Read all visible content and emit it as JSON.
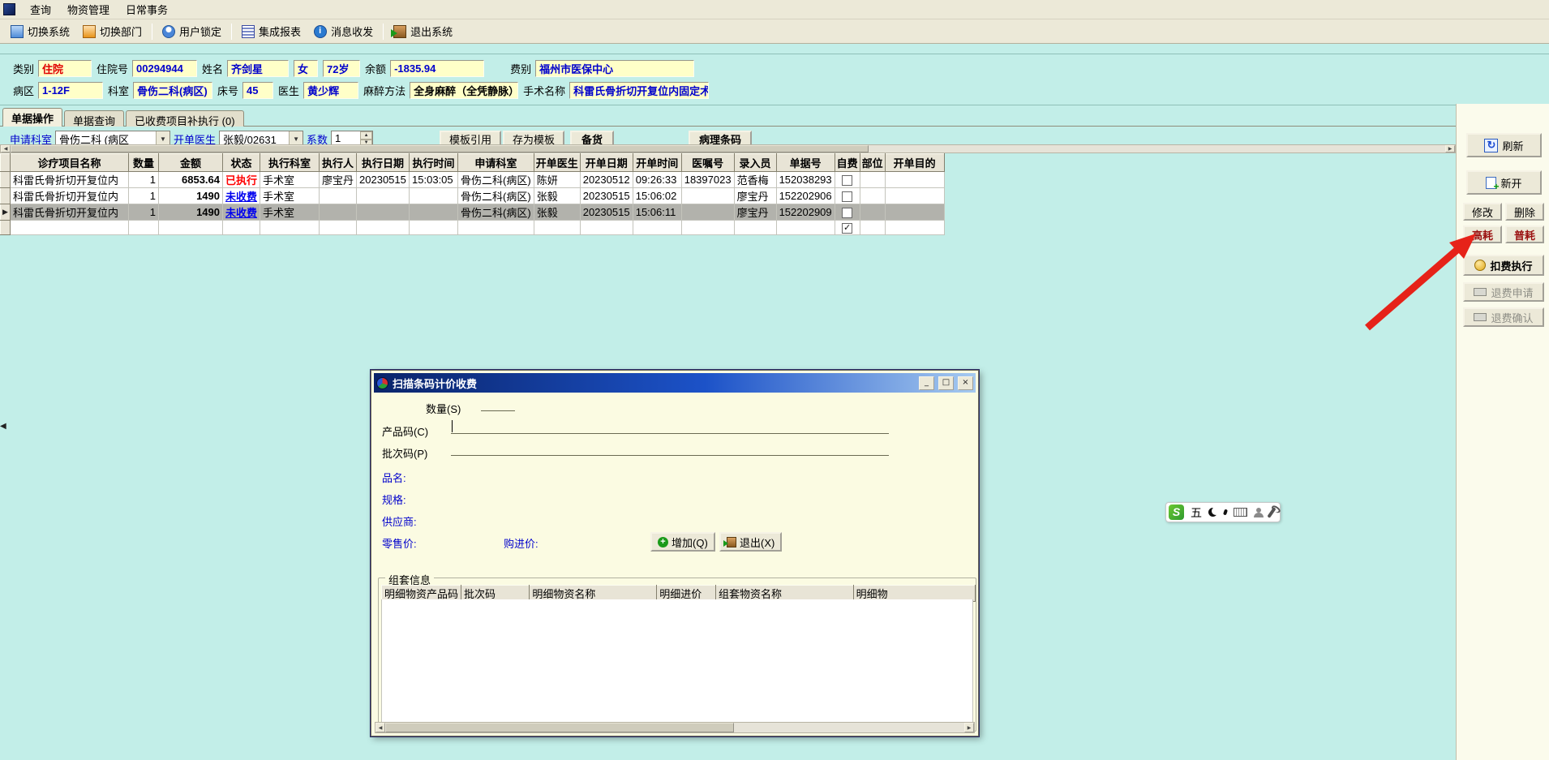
{
  "menu": {
    "items": [
      "查询",
      "物资管理",
      "日常事务"
    ]
  },
  "toolbar": {
    "items": [
      "切换系统",
      "切换部门",
      "用户锁定",
      "集成报表",
      "消息收发",
      "退出系统"
    ]
  },
  "patient": {
    "category_label": "类别",
    "category": "住院",
    "admission_label": "住院号",
    "admission_no": "00294944",
    "name_label": "姓名",
    "name": "齐剑星",
    "gender": "女",
    "age": "72岁",
    "balance_label": "余额",
    "balance": "-1835.94",
    "fee_label": "费别",
    "fee_type": "福州市医保中心",
    "ward_label": "病区",
    "ward": "1-12F",
    "dept_label": "科室",
    "dept": "骨伤二科(病区)",
    "bed_label": "床号",
    "bed": "45",
    "doctor_label": "医生",
    "doctor": "黄少辉",
    "anesthesia_label": "麻醉方法",
    "anesthesia": "全身麻醉（全凭静脉）",
    "surgery_label": "手术名称",
    "surgery": "科雷氏骨折切开复位内固定术"
  },
  "tabs": [
    {
      "label": "单据操作",
      "active": true
    },
    {
      "label": "单据查询",
      "active": false
    },
    {
      "label": "已收费项目补执行 (0)",
      "active": false
    }
  ],
  "form": {
    "apply_dept_label": "申请科室",
    "apply_dept": "骨伤二科 (病区",
    "order_doctor_label": "开单医生",
    "order_doctor": "张毅/02631",
    "coeff_label": "系数",
    "coeff_value": "1",
    "btn_template_ref": "模板引用",
    "btn_save_template": "存为模板",
    "btn_stock": "备货",
    "btn_pathology": "病理条码"
  },
  "grid": {
    "columns": [
      "诊疗项目名称",
      "数量",
      "金额",
      "状态",
      "执行科室",
      "执行人",
      "执行日期",
      "执行时间",
      "申请科室",
      "开单医生",
      "开单日期",
      "开单时间",
      "医嘱号",
      "录入员",
      "单据号",
      "自费",
      "部位",
      "开单目的"
    ],
    "rows": [
      {
        "name": "科雷氏骨折切开复位内",
        "qty": "1",
        "amount": "6853.64",
        "status": "已执行",
        "state": "done",
        "exec_dept": "手术室",
        "executor": "廖宝丹",
        "exec_date": "20230515",
        "exec_time": "15:03:05",
        "apply_dept": "骨伤二科(病区)",
        "doctor": "陈妍",
        "order_date": "20230512",
        "order_time": "09:26:33",
        "order_no": "18397023",
        "entry": "范香梅",
        "doc_no": "152038293",
        "self": false,
        "part": "",
        "purpose": "",
        "selected": false
      },
      {
        "name": "科雷氏骨折切开复位内",
        "qty": "1",
        "amount": "1490",
        "status": "未收费",
        "state": "unpaid",
        "exec_dept": "手术室",
        "executor": "",
        "exec_date": "",
        "exec_time": "",
        "apply_dept": "骨伤二科(病区)",
        "doctor": "张毅",
        "order_date": "20230515",
        "order_time": "15:06:02",
        "order_no": "",
        "entry": "廖宝丹",
        "doc_no": "152202906",
        "self": false,
        "part": "",
        "purpose": "",
        "selected": false
      },
      {
        "name": "科雷氏骨折切开复位内",
        "qty": "1",
        "amount": "1490",
        "status": "未收费",
        "state": "unpaid",
        "exec_dept": "手术室",
        "executor": "",
        "exec_date": "",
        "exec_time": "",
        "apply_dept": "骨伤二科(病区)",
        "doctor": "张毅",
        "order_date": "20230515",
        "order_time": "15:06:11",
        "order_no": "",
        "entry": "廖宝丹",
        "doc_no": "152202909",
        "self": false,
        "part": "",
        "purpose": "",
        "selected": true
      },
      {
        "name": "",
        "qty": "",
        "amount": "",
        "status": "",
        "state": "",
        "exec_dept": "",
        "executor": "",
        "exec_date": "",
        "exec_time": "",
        "apply_dept": "",
        "doctor": "",
        "order_date": "",
        "order_time": "",
        "order_no": "",
        "entry": "",
        "doc_no": "",
        "self": true,
        "part": "",
        "purpose": "",
        "selected": false
      }
    ]
  },
  "actions": {
    "refresh": "刷新",
    "new": "新开",
    "modify": "修改",
    "delete": "删除",
    "high": "高耗",
    "normal": "普耗",
    "deduct": "扣费执行",
    "refund_apply": "退费申请",
    "refund_confirm": "退费确认"
  },
  "dialog": {
    "title": "扫描条码计价收费",
    "qty_label": "数量(S)",
    "product_label": "产品码(C)",
    "batch_label": "批次码(P)",
    "name_label": "品名:",
    "spec_label": "规格:",
    "supplier_label": "供应商:",
    "retail_label": "零售价:",
    "purchase_label": "购进价:",
    "add_btn": "增加(Q)",
    "exit_btn": "退出(X)",
    "group_title": "组套信息",
    "columns": [
      "明细物资产品码",
      "批次码",
      "明细物资名称",
      "明细进价",
      "组套物资名称",
      "明细物"
    ],
    "win": {
      "minimize": "_",
      "maximize": "□",
      "close": "×"
    }
  },
  "ime": {
    "logo": "S",
    "mode": "五"
  },
  "colors": {
    "background": "#c2eee8",
    "field_yellow": "#ffffc8",
    "status_done": "#ff0000",
    "status_unpaid": "#0000ee",
    "arrow_red": "#e62219"
  }
}
